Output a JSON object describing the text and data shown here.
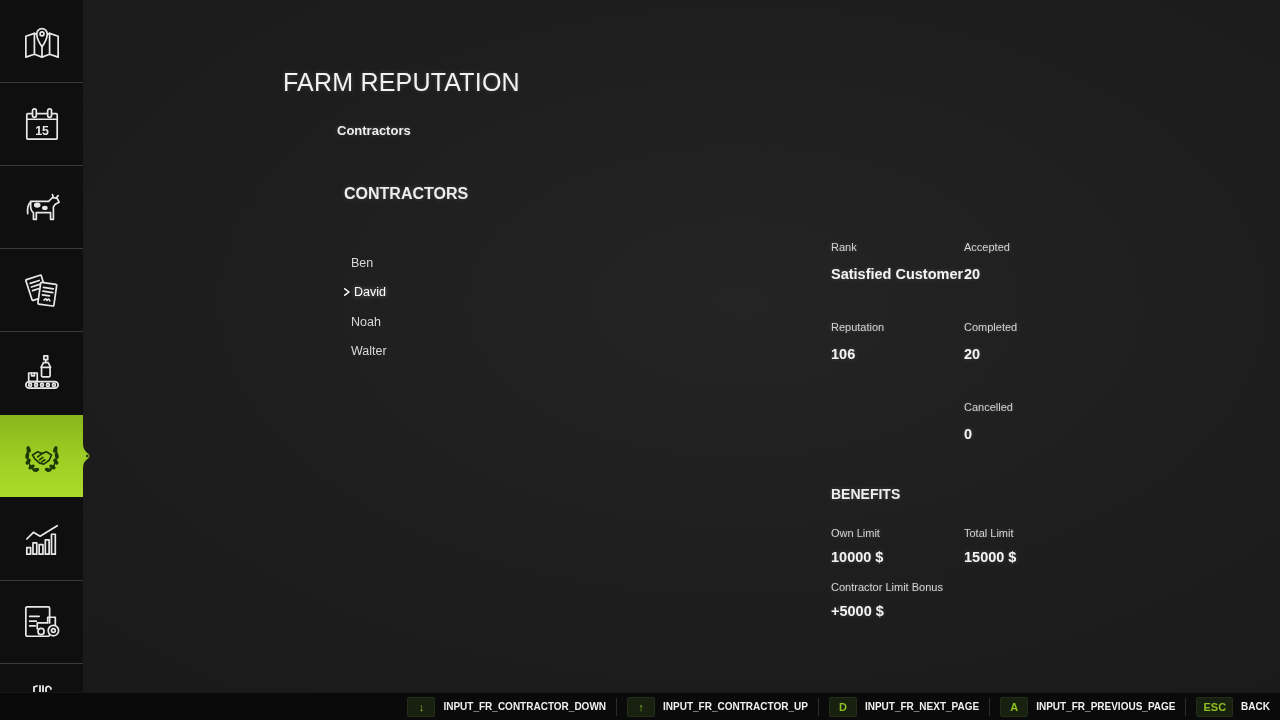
{
  "sidebar": {
    "items": [
      {
        "selected": false
      },
      {
        "selected": false,
        "icon_text": "15"
      },
      {
        "selected": false
      },
      {
        "selected": false
      },
      {
        "selected": false
      },
      {
        "selected": true
      },
      {
        "selected": false
      },
      {
        "selected": false
      },
      {
        "selected": false
      }
    ]
  },
  "page": {
    "title": "FARM REPUTATION",
    "subtitle": "Contractors"
  },
  "contractors": {
    "heading": "CONTRACTORS",
    "items": [
      {
        "name": "Ben",
        "selected": false
      },
      {
        "name": "David",
        "selected": true
      },
      {
        "name": "Noah",
        "selected": false
      },
      {
        "name": "Walter",
        "selected": false
      }
    ]
  },
  "details": {
    "columns": [
      {
        "fields": [
          {
            "label": "Rank",
            "value": "Satisfied Customer"
          },
          {
            "label": "Reputation",
            "value": "106"
          }
        ]
      },
      {
        "fields": [
          {
            "label": "Accepted",
            "value": "20"
          },
          {
            "label": "Completed",
            "value": "20"
          },
          {
            "label": "Cancelled",
            "value": "0"
          }
        ]
      }
    ]
  },
  "benefits": {
    "heading": "BENEFITS",
    "fields": [
      {
        "label": "Own Limit",
        "value": "10000 $"
      },
      {
        "label": "Total Limit",
        "value": "15000 $"
      },
      {
        "label": "Contractor Limit Bonus",
        "value": "+5000 $"
      }
    ]
  },
  "hotkeys": [
    {
      "key": "↓",
      "label": "INPUT_FR_CONTRACTOR_DOWN"
    },
    {
      "key": "↑",
      "label": "INPUT_FR_CONTRACTOR_UP"
    },
    {
      "key": "D",
      "label": "INPUT_FR_NEXT_PAGE"
    },
    {
      "key": "A",
      "label": "INPUT_FR_PREVIOUS_PAGE"
    },
    {
      "key": "ESC",
      "label": "BACK"
    }
  ]
}
